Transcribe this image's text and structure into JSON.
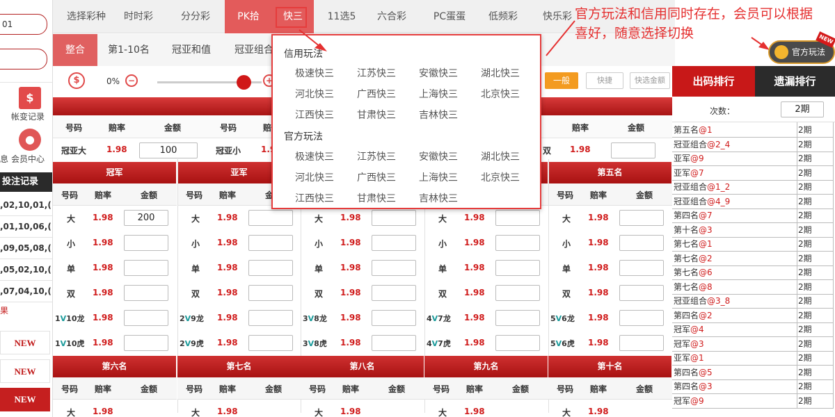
{
  "left": {
    "input1_value": "01",
    "input2_value": "",
    "tool_label1": "帐变记录",
    "tool_label2": "会员中心",
    "tool_label3": "息",
    "section_title": "投注记录",
    "records": [
      ",02,10,01,(",
      ",01,10,06,(",
      ",09,05,08,(",
      ",05,02,10,(",
      ",07,04,10,("
    ],
    "result_text": "果",
    "new_label": "NEW"
  },
  "topnav": {
    "tabs": [
      "选择彩种",
      "时时彩",
      "分分彩",
      "PK拾",
      "快三",
      "11选5",
      "六合彩",
      "PC蛋蛋",
      "低频彩",
      "快乐彩"
    ]
  },
  "subnav": {
    "tabs": [
      "整合",
      "第1-10名",
      "冠亚和值",
      "冠亚组合"
    ]
  },
  "toolbar": {
    "percent": "0%",
    "general_btn": "一般",
    "quick_btn": "快捷",
    "quick_amount_btn": "快选金额"
  },
  "table": {
    "col_no": "号码",
    "col_odds": "赔率",
    "col_amount": "金额",
    "row1": {
      "label1": "冠亚大",
      "odds1": "1.98",
      "amount1": "100",
      "label2": "冠亚小",
      "odds2": "1.9",
      "label3": "双",
      "odds3": "1.98"
    },
    "groups_top": [
      "冠军",
      "亚军",
      "",
      "",
      "第五名"
    ],
    "groups_bottom": [
      "第六名",
      "第七名",
      "第八名",
      "第九名",
      "第十名"
    ],
    "bet_rows": [
      {
        "labels": [
          "大",
          "大",
          "大",
          "大",
          "大"
        ],
        "odds": "1.98"
      },
      {
        "labels": [
          "小",
          "小",
          "小",
          "小",
          "小"
        ],
        "odds": "1.98"
      },
      {
        "labels": [
          "单",
          "单",
          "单",
          "单",
          "单"
        ],
        "odds": "1.98"
      },
      {
        "labels": [
          "双",
          "双",
          "双",
          "双",
          "双"
        ],
        "odds": "1.98"
      },
      {
        "labels": [
          "1V10龙",
          "2V9龙",
          "3V8龙",
          "4V7龙",
          "5V6龙"
        ],
        "odds": "1.98"
      },
      {
        "labels": [
          "1V10虎",
          "2V9虎",
          "3V8虎",
          "4V7虎",
          "5V6虎"
        ],
        "odds": "1.98"
      }
    ],
    "first_amount": "200",
    "partial_label": "大",
    "partial_odds": "1.98"
  },
  "right": {
    "tab1": "出码排行",
    "tab2": "遗漏排行",
    "count_label": "次数：",
    "count_value": "2期",
    "rows": [
      {
        "name": "第五名",
        "num": "@1",
        "period": "2期"
      },
      {
        "name": "冠亚组合",
        "num": "@2_4",
        "period": "2期"
      },
      {
        "name": "亚军",
        "num": "@9",
        "period": "2期"
      },
      {
        "name": "亚军",
        "num": "@7",
        "period": "2期"
      },
      {
        "name": "冠亚组合",
        "num": "@1_2",
        "period": "2期"
      },
      {
        "name": "冠亚组合",
        "num": "@4_9",
        "period": "2期"
      },
      {
        "name": "第四名",
        "num": "@7",
        "period": "2期"
      },
      {
        "name": "第十名",
        "num": "@3",
        "period": "2期"
      },
      {
        "name": "第七名",
        "num": "@1",
        "period": "2期"
      },
      {
        "name": "第七名",
        "num": "@2",
        "period": "2期"
      },
      {
        "name": "第七名",
        "num": "@6",
        "period": "2期"
      },
      {
        "name": "第七名",
        "num": "@8",
        "period": "2期"
      },
      {
        "name": "冠亚组合",
        "num": "@3_8",
        "period": "2期"
      },
      {
        "name": "第四名",
        "num": "@2",
        "period": "2期"
      },
      {
        "name": "冠军",
        "num": "@4",
        "period": "2期"
      },
      {
        "name": "冠军",
        "num": "@3",
        "period": "2期"
      },
      {
        "name": "亚军",
        "num": "@1",
        "period": "2期"
      },
      {
        "name": "第四名",
        "num": "@5",
        "period": "2期"
      },
      {
        "name": "第四名",
        "num": "@3",
        "period": "2期"
      },
      {
        "name": "冠军",
        "num": "@9",
        "period": "2期"
      }
    ]
  },
  "dropdown": {
    "credit_title": "信用玩法",
    "credit_items": [
      "极速快三",
      "江苏快三",
      "安徽快三",
      "湖北快三",
      "河北快三",
      "广西快三",
      "上海快三",
      "北京快三",
      "江西快三",
      "甘肃快三",
      "吉林快三"
    ],
    "official_title": "官方玩法",
    "official_items": [
      "极速快三",
      "江苏快三",
      "安徽快三",
      "湖北快三",
      "河北快三",
      "广西快三",
      "上海快三",
      "北京快三",
      "江西快三",
      "甘肃快三",
      "吉林快三"
    ]
  },
  "annotation": {
    "text": "官方玩法和信用同时存在，会员可以根据喜好，随意选择切换"
  },
  "official_button": {
    "label": "官方玩法",
    "badge": "NEW"
  },
  "colors": {
    "accent_red": "#d01c1c",
    "nav_active": "#e35b5b",
    "annotation": "#e53030",
    "number_blue": "#2c6fd1",
    "vs_teal": "#1a9a9a"
  }
}
